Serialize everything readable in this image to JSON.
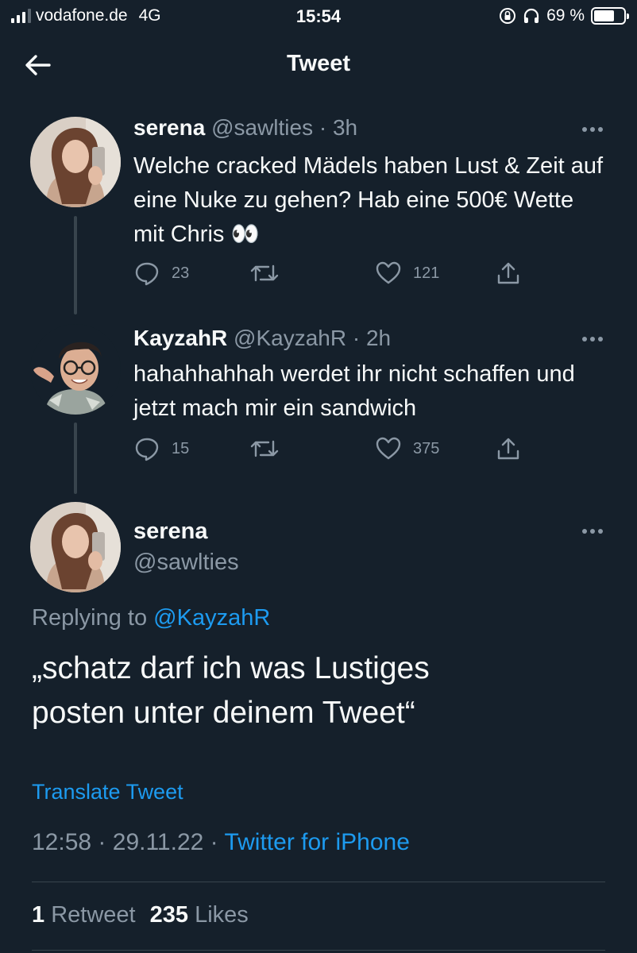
{
  "status_bar": {
    "carrier": "vodafone.de",
    "network": "4G",
    "time": "15:54",
    "battery": "69 %",
    "battery_level": 0.69
  },
  "header": {
    "title": "Tweet",
    "back_icon": "arrow-left-icon"
  },
  "thread": [
    {
      "name": "serena",
      "handle": "@sawlties",
      "time": "· 3h",
      "text": "Welche cracked Mädels haben Lust & Zeit auf eine Nuke zu gehen? Hab eine 500€ Wette mit Chris 👀",
      "replies": "23",
      "retweets": "",
      "likes": "121"
    },
    {
      "name": "KayzahR",
      "handle": "@KayzahR",
      "time": "· 2h",
      "text": "hahahhahhah werdet ihr nicht schaffen und jetzt mach mir ein sandwich",
      "replies": "15",
      "retweets": "",
      "likes": "375"
    }
  ],
  "main_tweet": {
    "name": "serena",
    "handle": "@sawlties",
    "replying_prefix": "Replying to ",
    "replying_to": "@KayzahR",
    "text": "„schatz darf ich was Lustiges posten unter deinem Tweet“",
    "translate": "Translate Tweet",
    "time": "12:58",
    "date": "29.11.22",
    "sep": "·",
    "source": "Twitter for iPhone",
    "retweets_count": "1",
    "retweets_label": "Retweet",
    "likes_count": "235",
    "likes_label": "Likes"
  },
  "colors": {
    "background": "#15202b",
    "accent": "#1d9bf0",
    "secondary_text": "#8b98a5"
  }
}
